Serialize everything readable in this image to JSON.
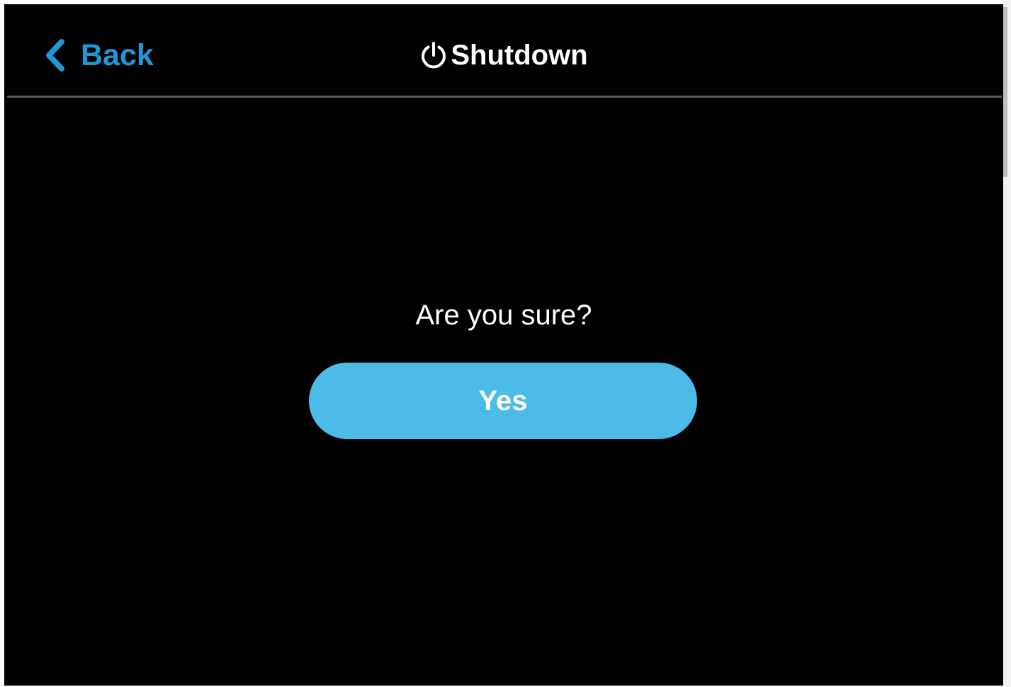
{
  "header": {
    "back_label": "Back",
    "title": "Shutdown",
    "title_icon": "power-icon",
    "back_icon": "chevron-left-icon"
  },
  "dialog": {
    "question": "Are you sure?",
    "confirm_label": "Yes"
  },
  "colors": {
    "background": "#000000",
    "accent": "#1f98d6",
    "button": "#4bbbe8",
    "text": "#ffffff",
    "divider": "#5a5a5a"
  }
}
